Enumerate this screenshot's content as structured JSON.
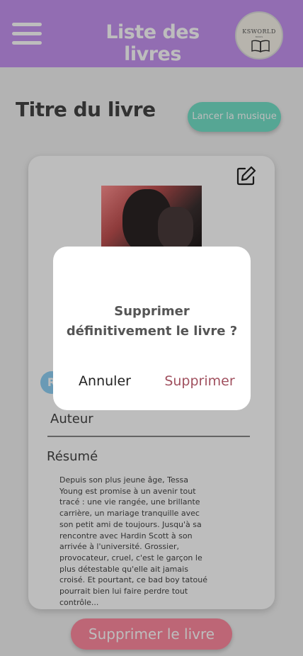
{
  "header": {
    "title": "Liste des livres",
    "logo_text": "KSWORLD",
    "logo_sub": "BOOKS",
    "color": "#c693f0"
  },
  "page": {
    "title": "Titre du livre",
    "music_button": "Lancer la musique"
  },
  "book": {
    "avatar_letter": "R",
    "author_label": "Auteur",
    "resume_label": "Résumé",
    "resume_text": "Depuis son plus jeune âge, Tessa Young est promise à un avenir tout tracé : une vie rangée, une brillante carrière, un mariage tranquille avec son petit ami de toujours. Jusqu'à sa rencontre avec Hardin Scott à son arrivée à l'université. Grossier, provocateur, cruel, c'est le garçon le plus détestable qu'elle ait jamais croisé. Et pourtant, ce bad boy tatoué pourrait bien lui faire perdre tout contrôle..."
  },
  "delete_button": "Supprimer le livre",
  "dialog": {
    "message": "Supprimer définitivement le livre ?",
    "cancel": "Annuler",
    "confirm": "Supprimer"
  },
  "colors": {
    "accent": "#c693f0",
    "music": "#74e0c8",
    "danger": "#ff8aa0",
    "confirm_text": "#a0505e"
  }
}
